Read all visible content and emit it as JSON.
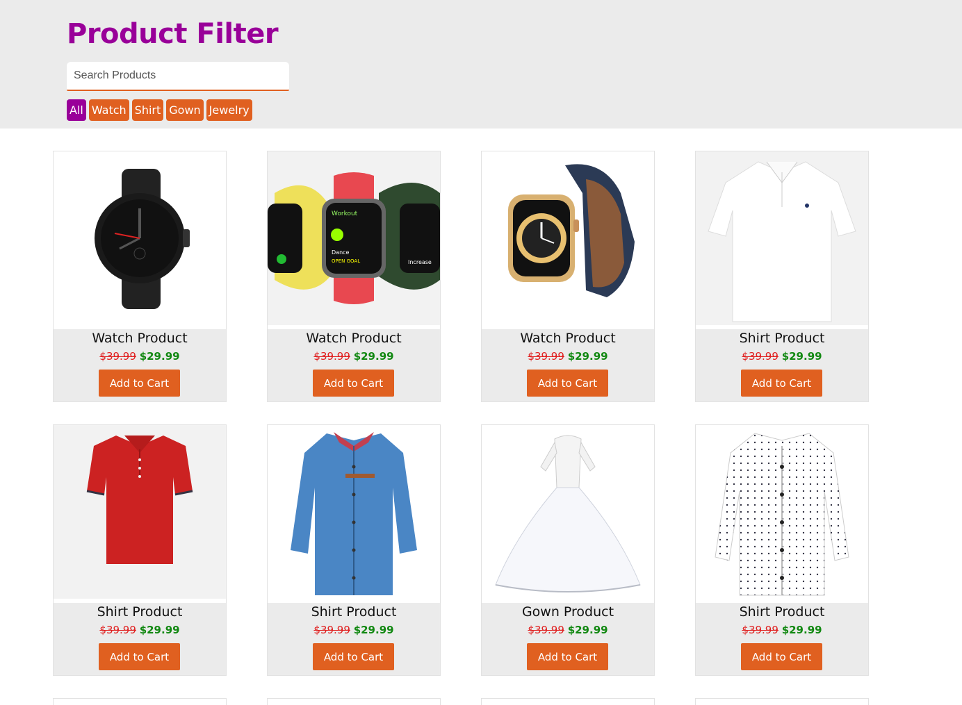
{
  "header": {
    "title": "Product Filter",
    "search_placeholder": "Search Products",
    "search_value": ""
  },
  "filters": [
    {
      "label": "All",
      "active": true
    },
    {
      "label": "Watch",
      "active": false
    },
    {
      "label": "Shirt",
      "active": false
    },
    {
      "label": "Gown",
      "active": false
    },
    {
      "label": "Jewelry",
      "active": false
    }
  ],
  "products": [
    {
      "name": "Watch Product",
      "old_price": "$39.99",
      "price": "$29.99",
      "button": "Add to Cart",
      "image": "black-watch"
    },
    {
      "name": "Watch Product",
      "old_price": "$39.99",
      "price": "$29.99",
      "button": "Add to Cart",
      "image": "smartwatch-trio"
    },
    {
      "name": "Watch Product",
      "old_price": "$39.99",
      "price": "$29.99",
      "button": "Add to Cart",
      "image": "gold-smartwatch"
    },
    {
      "name": "Shirt Product",
      "old_price": "$39.99",
      "price": "$29.99",
      "button": "Add to Cart",
      "image": "white-polo"
    },
    {
      "name": "Shirt Product",
      "old_price": "$39.99",
      "price": "$29.99",
      "button": "Add to Cart",
      "image": "red-polo"
    },
    {
      "name": "Shirt Product",
      "old_price": "$39.99",
      "price": "$29.99",
      "button": "Add to Cart",
      "image": "denim-shirt"
    },
    {
      "name": "Gown Product",
      "old_price": "$39.99",
      "price": "$29.99",
      "button": "Add to Cart",
      "image": "white-gown"
    },
    {
      "name": "Shirt Product",
      "old_price": "$39.99",
      "price": "$29.99",
      "button": "Add to Cart",
      "image": "dotted-shirt"
    }
  ],
  "colors": {
    "brand": "#990099",
    "accent": "#e06020",
    "old_price": "#e02020",
    "new_price": "#118811",
    "header_bg": "#ebebeb"
  }
}
